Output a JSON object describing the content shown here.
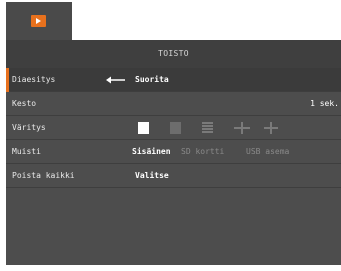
{
  "tabs": [
    {
      "icon": "play-icon",
      "color": "#e8711d"
    }
  ],
  "menu": {
    "title": "TOISTO",
    "rows": [
      {
        "label": "Diaesitys",
        "value": "Suorita",
        "icon": "enter-return-icon",
        "selected": true
      },
      {
        "label": "Kesto",
        "value": "1 sek."
      },
      {
        "label": "Väritys",
        "options": [
          "white-swatch",
          "grey-swatch",
          "lines-swatch",
          "cross-swatch",
          "cross-dot-swatch"
        ]
      },
      {
        "label": "Muisti",
        "value": "Sisäinen",
        "options": [
          "SD kortti",
          "USB asema"
        ]
      },
      {
        "label": "Poista kaikki",
        "value": "Valitse"
      }
    ]
  },
  "colors": {
    "accent": "#e8711d",
    "panel": "#4d4d4d",
    "header": "#3f3f3f"
  }
}
